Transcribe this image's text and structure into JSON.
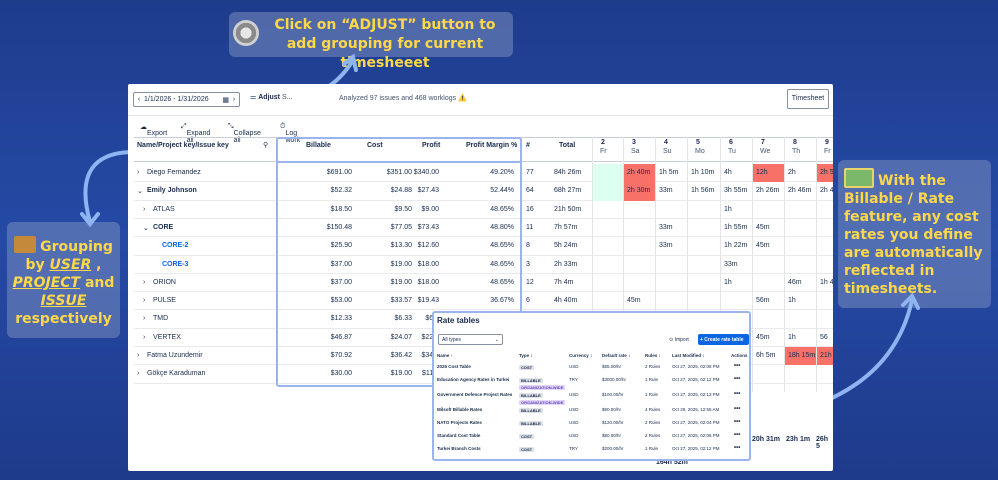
{
  "callouts": {
    "top": "Click on “ADJUST” button to add grouping for current timesheeet",
    "left_1": "Grouping by ",
    "left_user": "USER",
    "left_2": " , ",
    "left_project": "PROJECT",
    "left_3": " and ",
    "left_issue": "ISSUE",
    "left_4": " respectively",
    "right": "With the Billable / Rate feature, any cost rates you define are automatically reflected in timesheets."
  },
  "topbar": {
    "date_range": "1/1/2026 - 1/31/2026",
    "adjust_label": "Adjust",
    "adjust_more": "S...",
    "analyzed": "Analyzed 97 issues and 468 worklogs ⚠️",
    "timesheet": "Timesheet"
  },
  "toolbar": {
    "export": "Export",
    "expand": "Expand all",
    "collapse": "Collapse all",
    "log": "Log work"
  },
  "columns": {
    "key": "Name/Project key/Issue key",
    "billable": "Billable",
    "cost": "Cost",
    "profit": "Profit",
    "margin": "Profit Margin %",
    "hash": "#",
    "total": "Total",
    "days": [
      {
        "n": "2",
        "d": "Fr"
      },
      {
        "n": "3",
        "d": "Sa"
      },
      {
        "n": "4",
        "d": "Su"
      },
      {
        "n": "5",
        "d": "Mo"
      },
      {
        "n": "6",
        "d": "Tu"
      },
      {
        "n": "7",
        "d": "We"
      },
      {
        "n": "8",
        "d": "Th"
      },
      {
        "n": "9",
        "d": "Fr"
      }
    ]
  },
  "rows": [
    {
      "name": "Diego Fernandez",
      "level": 0,
      "billable": "$691.00",
      "cost": "$351.00",
      "profit": "$340.00",
      "margin": "49.20%",
      "hash": "77",
      "total": "84h 26m",
      "days": [
        "",
        "2h 40m",
        "1h 5m",
        "1h 10m",
        "4h",
        "12h",
        "2h",
        "2h 5"
      ]
    },
    {
      "name": "Emily Johnson",
      "level": 0,
      "billable": "$52.32",
      "cost": "$24.88",
      "profit": "$27.43",
      "margin": "52.44%",
      "hash": "64",
      "total": "68h 27m",
      "days": [
        "",
        "2h 30m",
        "33m",
        "1h 56m",
        "3h 55m",
        "2h 26m",
        "2h 46m",
        "2h 4"
      ]
    },
    {
      "name": "ATLAS",
      "level": 1,
      "billable": "$18.50",
      "cost": "$9.50",
      "profit": "$9.00",
      "margin": "48.65%",
      "hash": "16",
      "total": "21h 50m",
      "days": [
        "",
        "",
        "",
        "",
        "1h",
        "",
        "",
        ""
      ]
    },
    {
      "name": "CORE",
      "level": 1,
      "billable": "$150.48",
      "cost": "$77.05",
      "profit": "$73.43",
      "margin": "48.80%",
      "hash": "11",
      "total": "7h 57m",
      "days": [
        "",
        "",
        "33m",
        "",
        "1h 55m",
        "45m",
        "",
        ""
      ]
    },
    {
      "name": "CORE-2",
      "level": 2,
      "billable": "$25.90",
      "cost": "$13.30",
      "profit": "$12.60",
      "margin": "48.65%",
      "hash": "8",
      "total": "5h 24m",
      "days": [
        "",
        "",
        "33m",
        "",
        "1h 22m",
        "45m",
        "",
        ""
      ]
    },
    {
      "name": "CORE-3",
      "level": 2,
      "billable": "$37.00",
      "cost": "$19.00",
      "profit": "$18.00",
      "margin": "48.65%",
      "hash": "3",
      "total": "2h 33m",
      "days": [
        "",
        "",
        "",
        "",
        "33m",
        "",
        "",
        ""
      ]
    },
    {
      "name": "ORION",
      "level": 1,
      "billable": "$37.00",
      "cost": "$19.00",
      "profit": "$18.00",
      "margin": "48.65%",
      "hash": "12",
      "total": "7h 4m",
      "days": [
        "",
        "",
        "",
        "",
        "1h",
        "",
        "46m",
        "1h 4"
      ]
    },
    {
      "name": "PULSE",
      "level": 1,
      "billable": "$53.00",
      "cost": "$33.57",
      "profit": "$19.43",
      "margin": "36.67%",
      "hash": "6",
      "total": "4h 40m",
      "days": [
        "",
        "45m",
        "",
        "",
        "",
        "56m",
        "1h",
        ""
      ]
    },
    {
      "name": "TMD",
      "level": 1,
      "billable": "$12.33",
      "cost": "$6.33",
      "profit": "$6.0",
      "margin": "",
      "hash": "",
      "total": "",
      "days": [
        "",
        "",
        "",
        "",
        "",
        "",
        "",
        ""
      ]
    },
    {
      "name": "VERTEX",
      "level": 1,
      "billable": "$46.87",
      "cost": "$24.07",
      "profit": "$22.8",
      "margin": "",
      "hash": "",
      "total": "",
      "days": [
        "",
        "",
        "",
        "",
        "",
        "45m",
        "1h",
        "56"
      ]
    },
    {
      "name": "Fatma Uzundemir",
      "level": 0,
      "billable": "$70.92",
      "cost": "$36.42",
      "profit": "$34.5",
      "margin": "",
      "hash": "",
      "total": "",
      "days": [
        "",
        "",
        "",
        "",
        "",
        "6h 5m",
        "18h 15m",
        "21h 2"
      ]
    },
    {
      "name": "Gökçe Karaduman",
      "level": 0,
      "billable": "$30.00",
      "cost": "$19.00",
      "profit": "$11.0",
      "margin": "",
      "hash": "",
      "total": "",
      "days": [
        "",
        "",
        "",
        "",
        "",
        "",
        "",
        ""
      ]
    }
  ],
  "footer": {
    "grand_total": "164h 52m",
    "d7": "20h 31m",
    "d8": "23h 1m",
    "d9": "26h 5"
  },
  "rate_tables": {
    "title": "Rate tables",
    "filter": "All types",
    "import": "Import",
    "create": "+ Create rate table",
    "headers": [
      "Name ↑",
      "Type ↕",
      "Currency ↕",
      "Default rate ↕",
      "Rules ↕",
      "Last Modified ↕",
      "Actions"
    ],
    "rows": [
      {
        "name": "2025 Cost Table",
        "type": "COST",
        "type2": "",
        "cur": "USD",
        "rate": "$85.00/hr",
        "rules": "2 Rules",
        "mod": "Oct 27, 2025, 02:08 PM"
      },
      {
        "name": "Education Agency Rates in Turkei",
        "type": "BILLABLE",
        "type2": "ORGANIZATION-WIDE",
        "cur": "TRY",
        "rate": "$3000.00/hr",
        "rules": "1 Rule",
        "mod": "Oct 27, 2025, 02:12 PM"
      },
      {
        "name": "Government Defence Project Rates",
        "type": "BILLABLE",
        "type2": "ORGANIZATION-WIDE",
        "cur": "USD",
        "rate": "$100.00/hr",
        "rules": "1 Rule",
        "mod": "Oct 27, 2025, 02:13 PM"
      },
      {
        "name": "Milsoft Billable Rates",
        "type": "BILLABLE",
        "type2": "",
        "cur": "USD",
        "rate": "$90.00/hr",
        "rules": "4 Rules",
        "mod": "Oct 29, 2025, 12:55 AM"
      },
      {
        "name": "NATO Projects Rates",
        "type": "BILLABLE",
        "type2": "",
        "cur": "USD",
        "rate": "$120.00/hr",
        "rules": "2 Rules",
        "mod": "Oct 27, 2025, 02:04 PM"
      },
      {
        "name": "Standard Cost Table",
        "type": "COST",
        "type2": "",
        "cur": "USD",
        "rate": "$80.00/hr",
        "rules": "2 Rules",
        "mod": "Oct 27, 2025, 02:06 PM"
      },
      {
        "name": "Turkei Branch Costs",
        "type": "COST",
        "type2": "",
        "cur": "TRY",
        "rate": "$200.00/hr",
        "rules": "1 Rule",
        "mod": "Oct 27, 2025, 02:12 PM"
      }
    ]
  }
}
